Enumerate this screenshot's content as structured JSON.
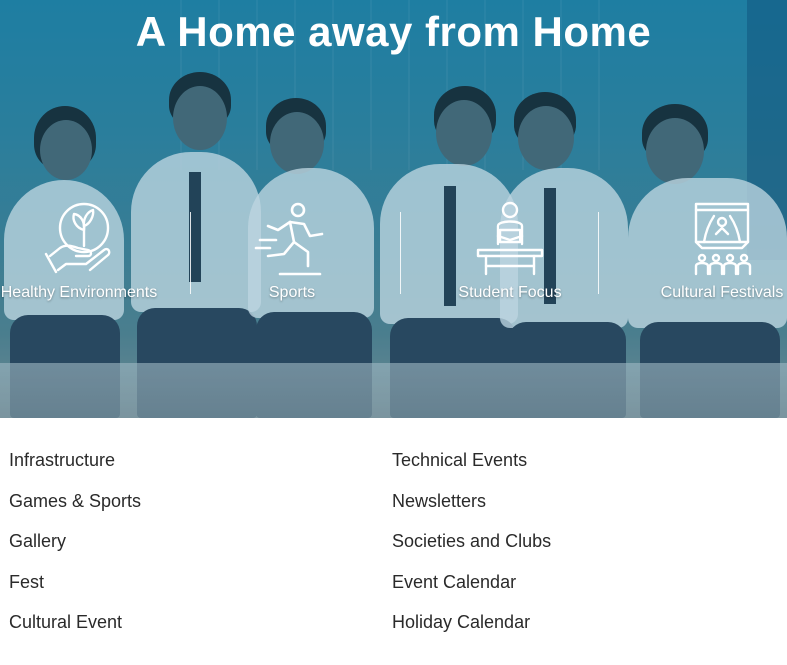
{
  "hero": {
    "title": "A Home away from Home",
    "features": [
      {
        "label": "Healthy Environments",
        "icon": "plant-in-hand-icon"
      },
      {
        "label": "Sports",
        "icon": "running-person-icon"
      },
      {
        "label": "Student Focus",
        "icon": "student-reading-icon"
      },
      {
        "label": "Cultural Festivals",
        "icon": "stage-audience-icon"
      }
    ]
  },
  "links": {
    "left": [
      "Infrastructure",
      "Games & Sports",
      "Gallery",
      "Fest",
      "Cultural Event"
    ],
    "right": [
      "Technical Events",
      "Newsletters",
      "Societies and Clubs",
      "Event Calendar",
      "Holiday Calendar"
    ]
  },
  "colors": {
    "hero_tint": "#1f7fa3",
    "link_text": "#2a2a2a",
    "icon": "#ffffff"
  }
}
